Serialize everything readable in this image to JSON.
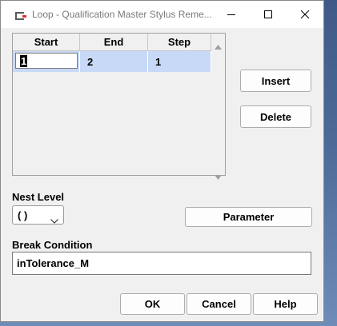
{
  "window": {
    "title": "Loop - Qualification Master Stylus Reme..."
  },
  "titlebar": {
    "icons": {
      "app": "loop-app-icon",
      "minimize": "minimize-icon",
      "maximize": "maximize-icon",
      "close": "close-icon"
    }
  },
  "grid": {
    "columns": [
      "Start",
      "End",
      "Step"
    ],
    "rows": [
      {
        "start": "1",
        "end": "2",
        "step": "1"
      }
    ],
    "selected_row_color": "#c7d9f7"
  },
  "buttons": {
    "insert": "Insert",
    "delete": "Delete",
    "parameter": "Parameter",
    "ok": "OK",
    "cancel": "Cancel",
    "help": "Help"
  },
  "nest_level": {
    "label": "Nest Level",
    "value": "( )"
  },
  "break_condition": {
    "label": "Break Condition",
    "value": "inTolerance_M"
  }
}
